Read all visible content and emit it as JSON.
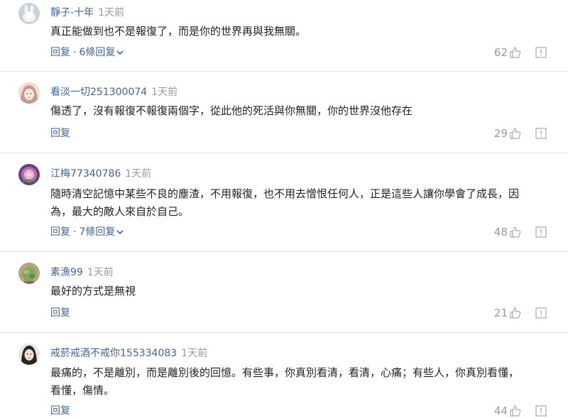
{
  "comments": [
    {
      "username": "靜子-十年",
      "time": "1天前",
      "content": "真正能做到也不是報復了，而是你的世界再與我無關。",
      "reply": "回复",
      "more_replies": "6條回复",
      "likes": "62",
      "avatar_icon": "rabbit-avatar"
    },
    {
      "username": "看淡一切251300074",
      "time": "1天前",
      "content": "傷透了，沒有報復不報復兩個字，從此他的死活與你無關，你的世界沒他存在",
      "reply": "回复",
      "likes": "29",
      "avatar_icon": "girl-avatar"
    },
    {
      "username": "江梅77340786",
      "time": "1天前",
      "content_lines": [
        "隨時清空記憶中某些不良的塵渣，不用報復，也不用去憎恨任何人，正是這些人讓你學會了成長，因",
        "為，最大的敵人來自於自己。"
      ],
      "reply": "回复",
      "more_replies": "7條回复",
      "likes": "48",
      "avatar_icon": "flower-avatar"
    },
    {
      "username": "素漁99",
      "time": "1天前",
      "content": "最好的方式是無視",
      "reply": "回复",
      "likes": "21",
      "avatar_icon": "plant-avatar"
    },
    {
      "username": "戒菸戒酒不戒你155334083",
      "time": "1天前",
      "content_lines": [
        "最痛的，不是離別，而是離別後的回憶。有些事，你真別看清，看清，心痛；有些人，你真別看懂，",
        "看懂，傷情。"
      ],
      "reply": "回复",
      "likes": "44",
      "avatar_icon": "woman-avatar"
    }
  ],
  "colors": {
    "username": "#406599",
    "meta": "#999999",
    "text": "#222222",
    "divider": "#e8e8e8"
  }
}
